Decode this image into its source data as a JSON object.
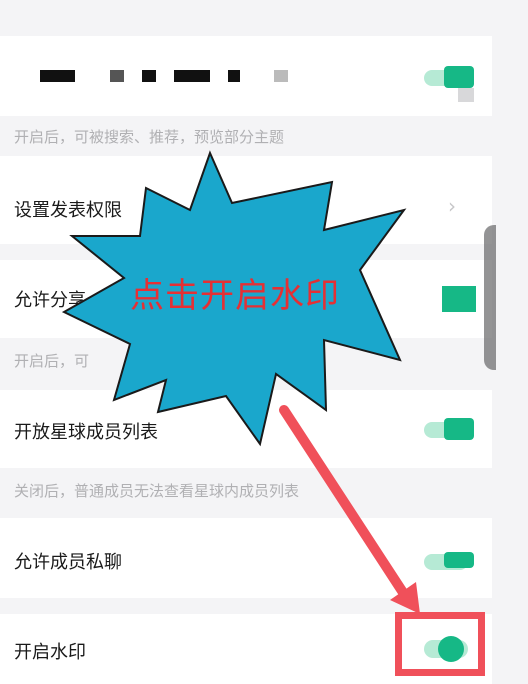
{
  "settings": {
    "hint_public": "开启后，可被搜索、推荐，预览部分主题",
    "post_permission_label": "设置发表权限",
    "post_permission_chevron": "›",
    "allow_share_label": "允许分享",
    "hint_share": "开启后，可",
    "member_list_label": "开放星球成员列表",
    "hint_member_list": "关闭后，普通成员无法查看星球内成员列表",
    "private_chat_label": "允许成员私聊",
    "watermark_label": "开启水印"
  },
  "annotation": {
    "callout_text": "点击开启水印",
    "callout_color": "#1aa7cc",
    "text_color": "#e53034",
    "arrow_color": "#f0505a"
  },
  "colors": {
    "toggle_on": "#16b886",
    "toggle_track": "#b6ead5"
  }
}
